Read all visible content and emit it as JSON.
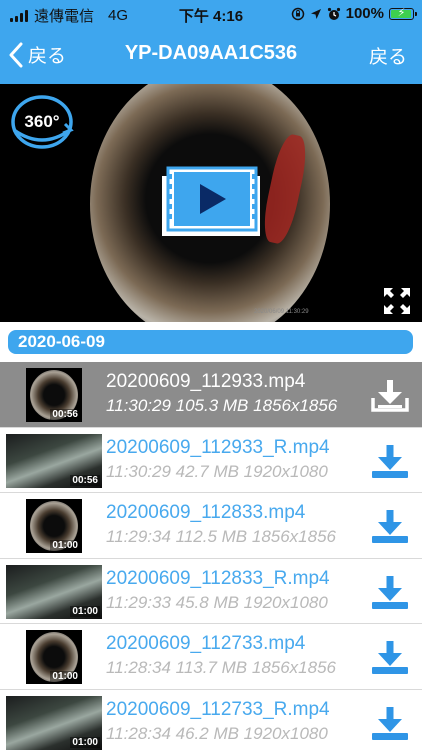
{
  "status": {
    "carrier": "遠傳電信",
    "network": "4G",
    "time": "下午 4:16",
    "battery": "100%",
    "battery_level": 1.0,
    "icons": [
      "rotation-lock-icon",
      "location-icon",
      "alarm-icon"
    ]
  },
  "nav": {
    "back_label": "戻る",
    "title": "YP-DA09AA1C536",
    "right_label": "戻る"
  },
  "player": {
    "badge": "360°",
    "overlay_timestamp": "2020/06/09 11:30:29"
  },
  "date_header": "2020-06-09",
  "files": [
    {
      "name": "20200609_112933.mp4",
      "meta": "11:30:29 105.3 MB 1856x1856",
      "duration": "00:56",
      "thumb": "sq",
      "selected": true
    },
    {
      "name": "20200609_112933_R.mp4",
      "meta": "11:30:29 42.7 MB 1920x1080",
      "duration": "00:56",
      "thumb": "wide",
      "selected": false
    },
    {
      "name": "20200609_112833.mp4",
      "meta": "11:29:34 112.5 MB 1856x1856",
      "duration": "01:00",
      "thumb": "sq",
      "selected": false
    },
    {
      "name": "20200609_112833_R.mp4",
      "meta": "11:29:33 45.8 MB 1920x1080",
      "duration": "01:00",
      "thumb": "wide",
      "selected": false
    },
    {
      "name": "20200609_112733.mp4",
      "meta": "11:28:34 113.7 MB 1856x1856",
      "duration": "01:00",
      "thumb": "sq",
      "selected": false
    },
    {
      "name": "20200609_112733_R.mp4",
      "meta": "11:28:34 46.2 MB 1920x1080",
      "duration": "01:00",
      "thumb": "wide",
      "selected": false
    }
  ],
  "colors": {
    "accent": "#3ea6ee",
    "filename": "#48a9ee",
    "meta": "#b9b9b9",
    "selected_row": "#8c8c8c"
  }
}
